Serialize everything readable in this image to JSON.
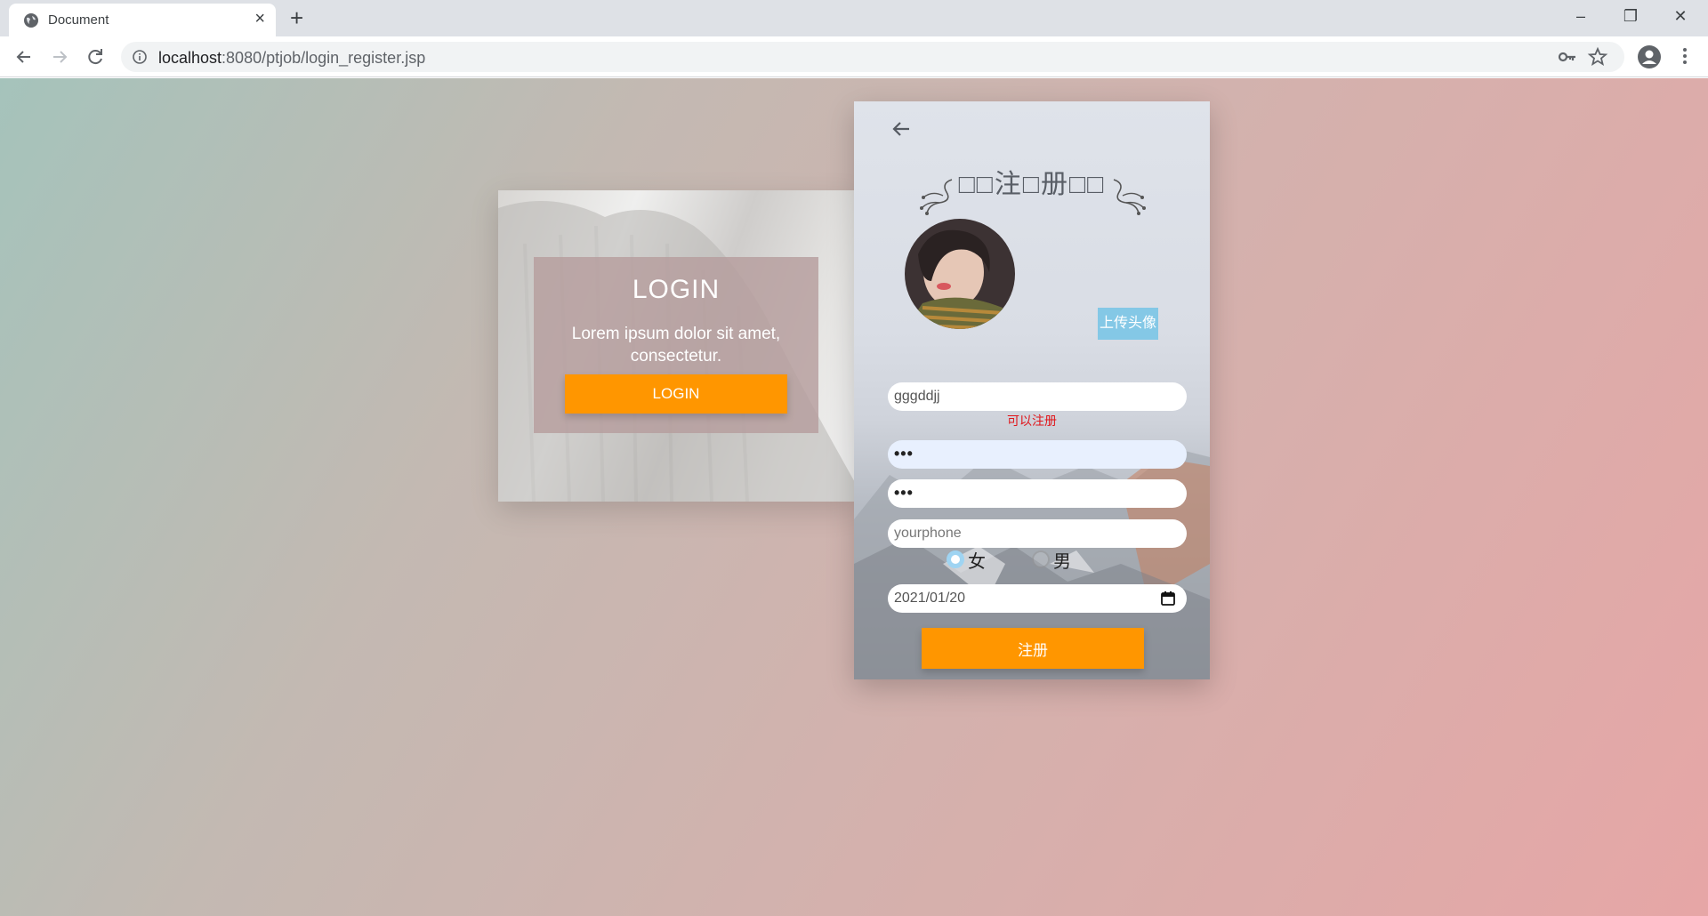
{
  "browser": {
    "tab_title": "Document",
    "tab_close": "×",
    "new_tab": "+",
    "url_host": "localhost",
    "url_rest": ":8080/ptjob/login_register.jsp",
    "window_controls": [
      "–",
      "❐",
      "✕"
    ]
  },
  "login": {
    "title": "LOGIN",
    "description": "Lorem ipsum dolor sit amet, consectetur.",
    "button_label": "LOGIN"
  },
  "register": {
    "title": "□□注□册□□",
    "upload_label": "上传头像",
    "username_value": "gggddjj",
    "status_message": "可以注册",
    "password_value": "•••",
    "confirm_password_value": "•••",
    "phone_placeholder": "yourphone",
    "gender_options": [
      {
        "label": "女",
        "checked": true
      },
      {
        "label": "男",
        "checked": false
      }
    ],
    "birthday_value": "2021/01/20",
    "submit_label": "注册"
  },
  "colors": {
    "accent_orange": "#ff9600",
    "upload_blue": "#84c8e6",
    "status_red": "#e0151a"
  }
}
